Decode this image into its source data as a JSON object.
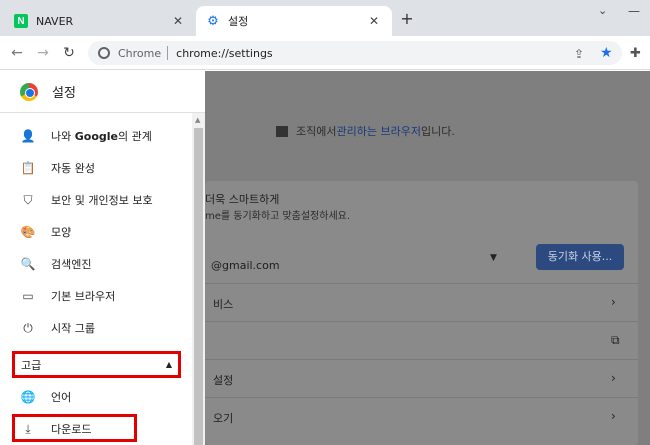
{
  "tabs": [
    {
      "title": "NAVER",
      "favicon": "N"
    },
    {
      "title": "설정",
      "favicon": "gear"
    }
  ],
  "toolbar": {
    "omnibox_chip": "Chrome",
    "url": "chrome://settings"
  },
  "sidebar": {
    "title": "설정",
    "items": [
      {
        "label_pre": "나와 ",
        "label_bold": "Google",
        "label_post": "의 관계",
        "icon": "person-icon"
      },
      {
        "label": "자동 완성",
        "icon": "clipboard-icon"
      },
      {
        "label": "보안 및 개인정보 보호",
        "icon": "shield-icon"
      },
      {
        "label": "모양",
        "icon": "palette-icon"
      },
      {
        "label": "검색엔진",
        "icon": "search-icon"
      },
      {
        "label": "기본 브라우저",
        "icon": "browser-icon"
      },
      {
        "label": "시작 그룹",
        "icon": "power-icon"
      }
    ],
    "advanced": "고급",
    "sub_items": [
      {
        "label": "언어",
        "icon": "globe-icon"
      },
      {
        "label": "다운로드",
        "icon": "download-icon"
      }
    ]
  },
  "main": {
    "managed_pre": "조직에서 ",
    "managed_link": "관리하는 브라우저",
    "managed_post": "입니다.",
    "sync_title": "더욱 스마트하게",
    "sync_sub": "me를 동기화하고 맞춤설정하세요.",
    "email": "@gmail.com",
    "sync_button": "동기화 사용...",
    "rows": [
      "비스",
      "",
      "설정",
      "오기"
    ]
  },
  "colors": {
    "accent": "#1a73e8",
    "highlight_box": "#e30000",
    "naver_green": "#03c75a"
  }
}
